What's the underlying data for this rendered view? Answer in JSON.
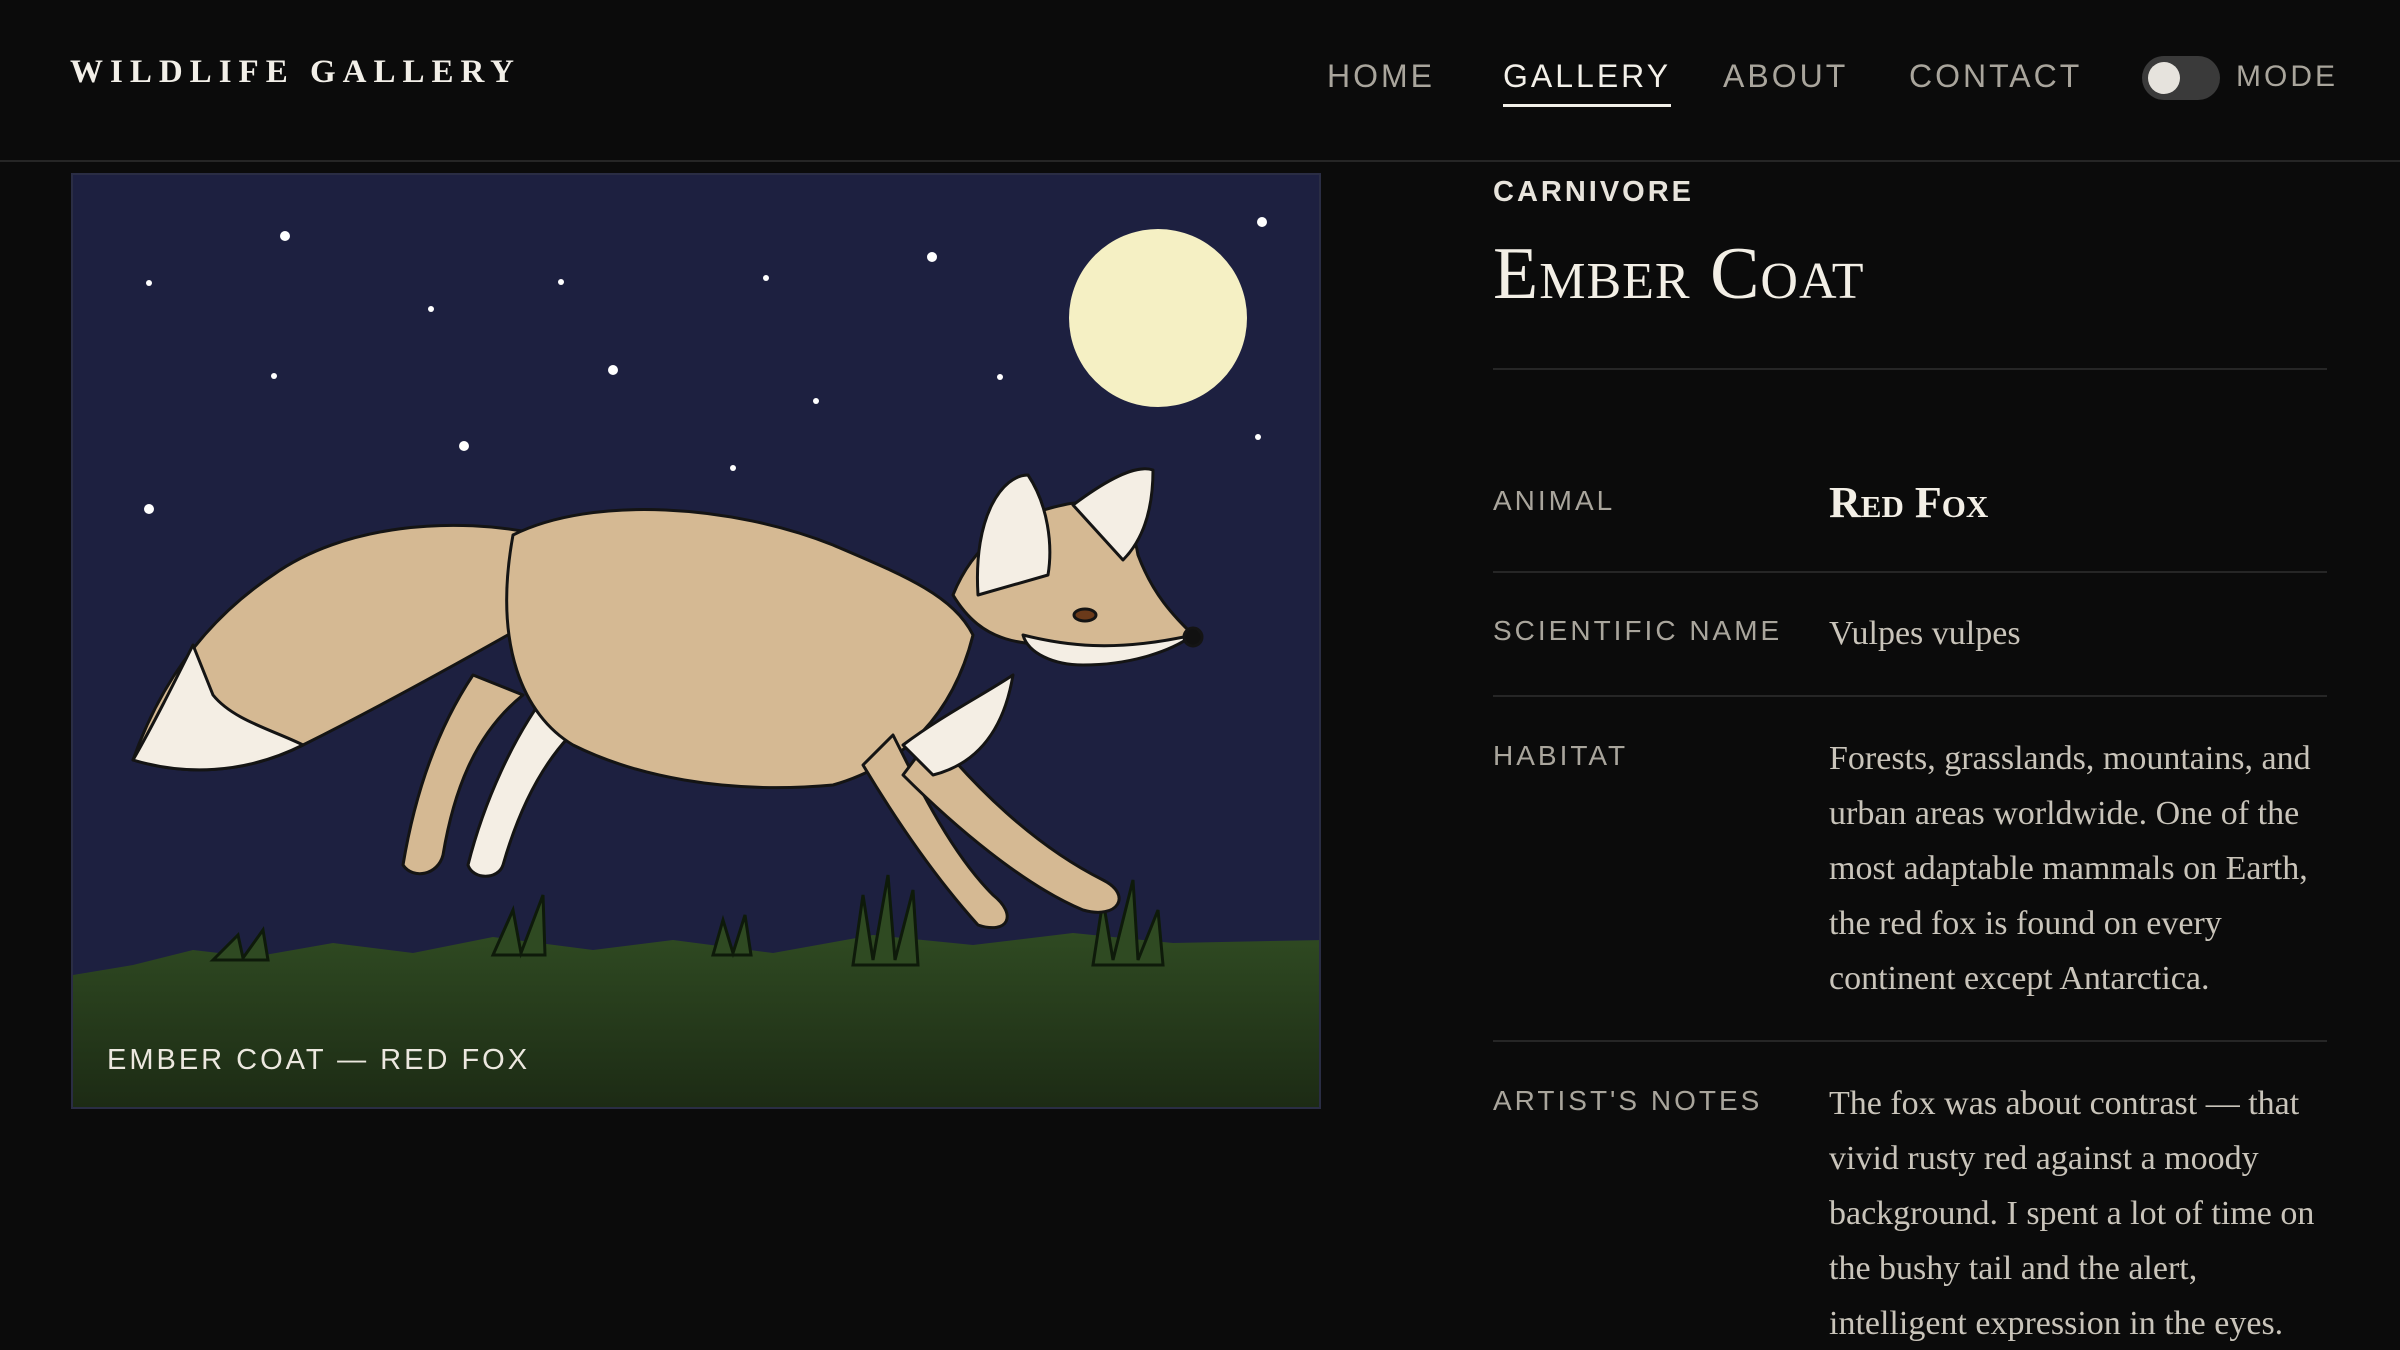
{
  "header": {
    "brand": "WILDLIFE GALLERY",
    "nav": {
      "home": "HOME",
      "gallery": "GALLERY",
      "about": "ABOUT",
      "contact": "CONTACT"
    },
    "active_nav": "GALLERY",
    "mode_label": "MODE",
    "mode_toggle_on": false
  },
  "artwork": {
    "caption": "EMBER COAT — RED FOX",
    "colors": {
      "sky": "#1d2040",
      "moon": "#f5f0c4",
      "grass": "#2f4a22",
      "fox_body": "#d5b993",
      "fox_white": "#f4eee4"
    }
  },
  "details": {
    "category": "CARNIVORE",
    "title": "Ember Coat",
    "animal_label": "ANIMAL",
    "animal_value": "Red Fox",
    "scientific_label": "SCIENTIFIC NAME",
    "scientific_value": "Vulpes vulpes",
    "habitat_label": "HABITAT",
    "habitat_value": "Forests, grasslands, mountains, and urban areas worldwide. One of the most adaptable mammals on Earth, the red fox is found on every continent except Antarctica.",
    "notes_label": "ARTIST'S NOTES",
    "notes_value": "The fox was about contrast — that vivid rusty red against a moody background. I spent a lot of time on the bushy tail and the alert, intelligent expression in the eyes."
  }
}
